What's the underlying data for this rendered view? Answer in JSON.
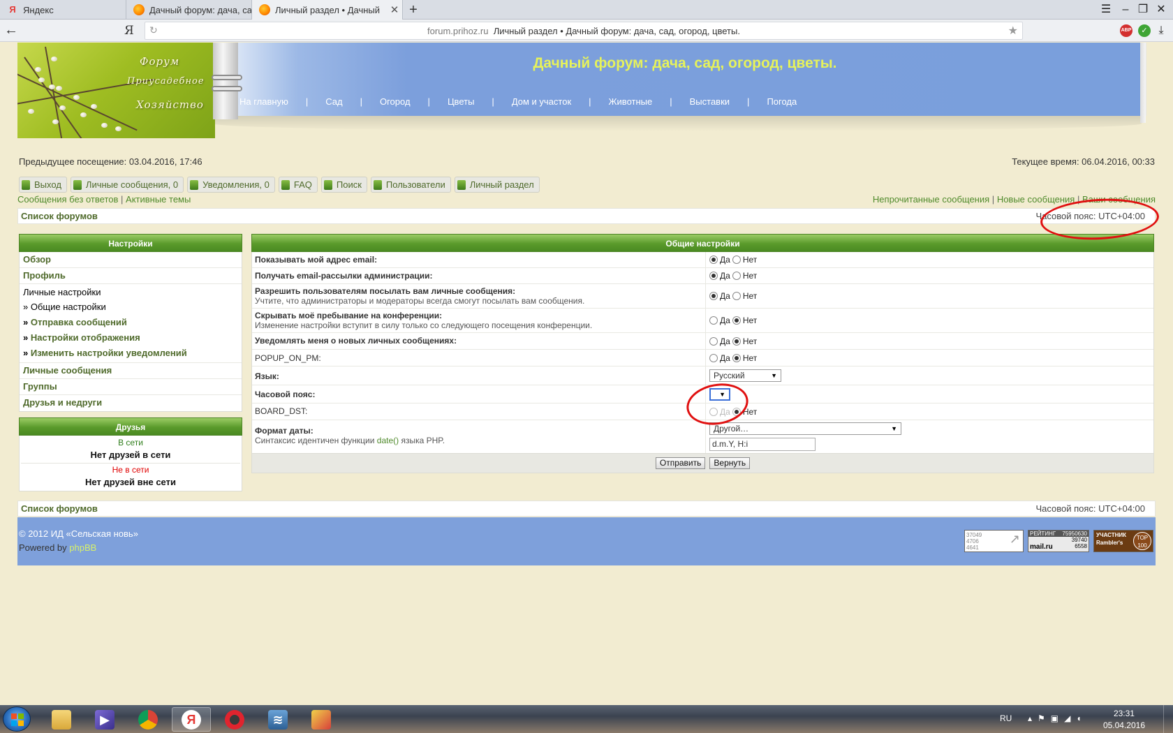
{
  "browser": {
    "tabs": [
      {
        "title": "Яндекс",
        "icon": "yandex-icon",
        "active": false
      },
      {
        "title": "Дачный форум: дача, сад, ог",
        "icon": "fruit-icon",
        "active": false
      },
      {
        "title": "Личный раздел • Дачный",
        "icon": "fruit-icon",
        "active": true
      }
    ],
    "new_tab": "+",
    "yandex_btn": "Я",
    "url_host": "forum.prihoz.ru",
    "url_title": "Личный раздел • Дачный форум: дача, сад, огород, цветы.",
    "ext_abp": "ABP",
    "ext_shield": "✓"
  },
  "header": {
    "logo_words": [
      "Форум",
      "Приусадебное",
      "Хозяйство"
    ],
    "site_title": "Дачный форум: дача, сад, огород, цветы.",
    "nav": [
      "На главную",
      "Сад",
      "Огород",
      "Цветы",
      "Дом и участок",
      "Животные",
      "Выставки",
      "Погода"
    ],
    "nav_sep": "|"
  },
  "visit": {
    "last_visit": "Предыдущее посещение: 03.04.2016, 17:46",
    "current_time": "Текущее время: 06.04.2016, 00:33"
  },
  "quicklinks": [
    "Выход",
    "Личные сообщения, 0",
    "Уведомления, 0",
    "FAQ",
    "Поиск",
    "Пользователи",
    "Личный раздел"
  ],
  "search_links": {
    "left": [
      "Сообщения без ответов",
      "Активные темы"
    ],
    "right": [
      "Непрочитанные сообщения",
      "Новые сообщения",
      "Ваши сообщения"
    ],
    "sep": "|"
  },
  "navbar": {
    "crumb": "Список форумов",
    "timezone": "Часовой пояс: UTC+04:00"
  },
  "left_panel": {
    "title": "Настройки",
    "items": {
      "overview": "Обзор",
      "profile": "Профиль",
      "personal": "Личные настройки",
      "general": "» Общие настройки",
      "posting": "Отправка сообщений",
      "display": "Настройки отображения",
      "notify": "Изменить настройки уведомлений",
      "pm": "Личные сообщения",
      "groups": "Группы",
      "friends_foes": "Друзья и недруги"
    },
    "raquo": "»",
    "friends": {
      "title": "Друзья",
      "online_label": "В сети",
      "online_none": "Нет друзей в сети",
      "offline_label": "Не в сети",
      "offline_none": "Нет друзей вне сети"
    }
  },
  "settings": {
    "title": "Общие настройки",
    "yes": "Да",
    "no": "Нет",
    "rows": [
      {
        "label": "Показывать мой адрес email:",
        "yes": true
      },
      {
        "label": "Получать email-рассылки администрации:",
        "yes": true
      },
      {
        "label": "Разрешить пользователям посылать вам личные сообщения:",
        "desc": "Учтите, что администраторы и модераторы всегда смогут посылать вам сообщения.",
        "yes": true
      },
      {
        "label": "Скрывать моё пребывание на конференции:",
        "desc": "Изменение настройки вступит в силу только со следующего посещения конференции.",
        "yes": false
      },
      {
        "label": "Уведомлять меня о новых личных сообщениях:",
        "yes": false
      },
      {
        "label": "POPUP_ON_PM:",
        "yes": false
      },
      {
        "label": "Язык:"
      },
      {
        "label": "Часовой пояс:"
      },
      {
        "label": "BOARD_DST:"
      },
      {
        "label": "Формат даты:",
        "desc_prefix": "Синтаксис идентичен функции ",
        "desc_link": "date()",
        "desc_suffix": " языка PHP."
      }
    ],
    "language_value": "Русский",
    "timezone_value": "",
    "dst_yes": "Да",
    "dst_no": "Нет",
    "date_format_select": "Другой…",
    "date_format_input": "d.m.Y, H:i",
    "submit": "Отправить",
    "reset": "Вернуть"
  },
  "footer": {
    "copyright": "© 2012 ИД «Сельская новь»",
    "powered_prefix": "Powered by ",
    "powered_link": "phpBB",
    "counter1": [
      "37049",
      "4706",
      "4641"
    ],
    "counter2": [
      "РЕЙТИНГ",
      "75950630",
      "39740",
      "6558",
      "mail.ru"
    ],
    "counter3": [
      "УЧАСТНИК",
      "Rambler's",
      "TOP",
      "100"
    ]
  },
  "taskbar": {
    "lang": "RU",
    "time": "23:31",
    "date": "05.04.2016"
  },
  "colors": {
    "accent_green": "#4f8a2b",
    "header_blue": "#7a9fdc",
    "title_yellow": "#e6f25b",
    "highlight_red": "#e01010",
    "page_bg": "#f2ecd1"
  }
}
